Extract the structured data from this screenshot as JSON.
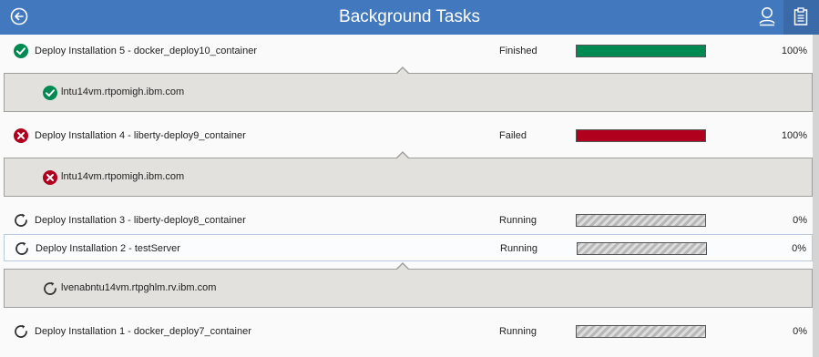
{
  "header": {
    "title": "Background Tasks",
    "icons": {
      "back": "back-arrow-icon",
      "user": "user-icon",
      "tasks": "clipboard-icon"
    },
    "colors": {
      "bar": "#4178be",
      "active_button": "#3a6aa8"
    }
  },
  "status_colors": {
    "finished": "#008a52",
    "failed": "#b0001e",
    "running": "#bdbdbd"
  },
  "tasks": [
    {
      "name": "Deploy Installation 5 - docker_deploy10_container",
      "status": "Finished",
      "progress_label": "100%",
      "progress_value": 100,
      "state": "finished",
      "selected": false,
      "detail": {
        "host": "lntu14vm.rtpomigh.ibm.com",
        "state": "finished"
      }
    },
    {
      "name": "Deploy Installation 4 - liberty-deploy9_container",
      "status": "Failed",
      "progress_label": "100%",
      "progress_value": 100,
      "state": "failed",
      "selected": false,
      "detail": {
        "host": "lntu14vm.rtpomigh.ibm.com",
        "state": "failed"
      }
    },
    {
      "name": "Deploy Installation 3 - liberty-deploy8_container",
      "status": "Running",
      "progress_label": "0%",
      "progress_value": 100,
      "state": "running",
      "selected": false,
      "detail": null
    },
    {
      "name": "Deploy Installation 2 - testServer",
      "status": "Running",
      "progress_label": "0%",
      "progress_value": 100,
      "state": "running",
      "selected": true,
      "detail": {
        "host": "lvenabntu14vm.rtpghlm.rv.ibm.com",
        "state": "running"
      }
    },
    {
      "name": "Deploy Installation 1 - docker_deploy7_container",
      "status": "Running",
      "progress_label": "0%",
      "progress_value": 100,
      "state": "running",
      "selected": false,
      "detail": null
    }
  ]
}
